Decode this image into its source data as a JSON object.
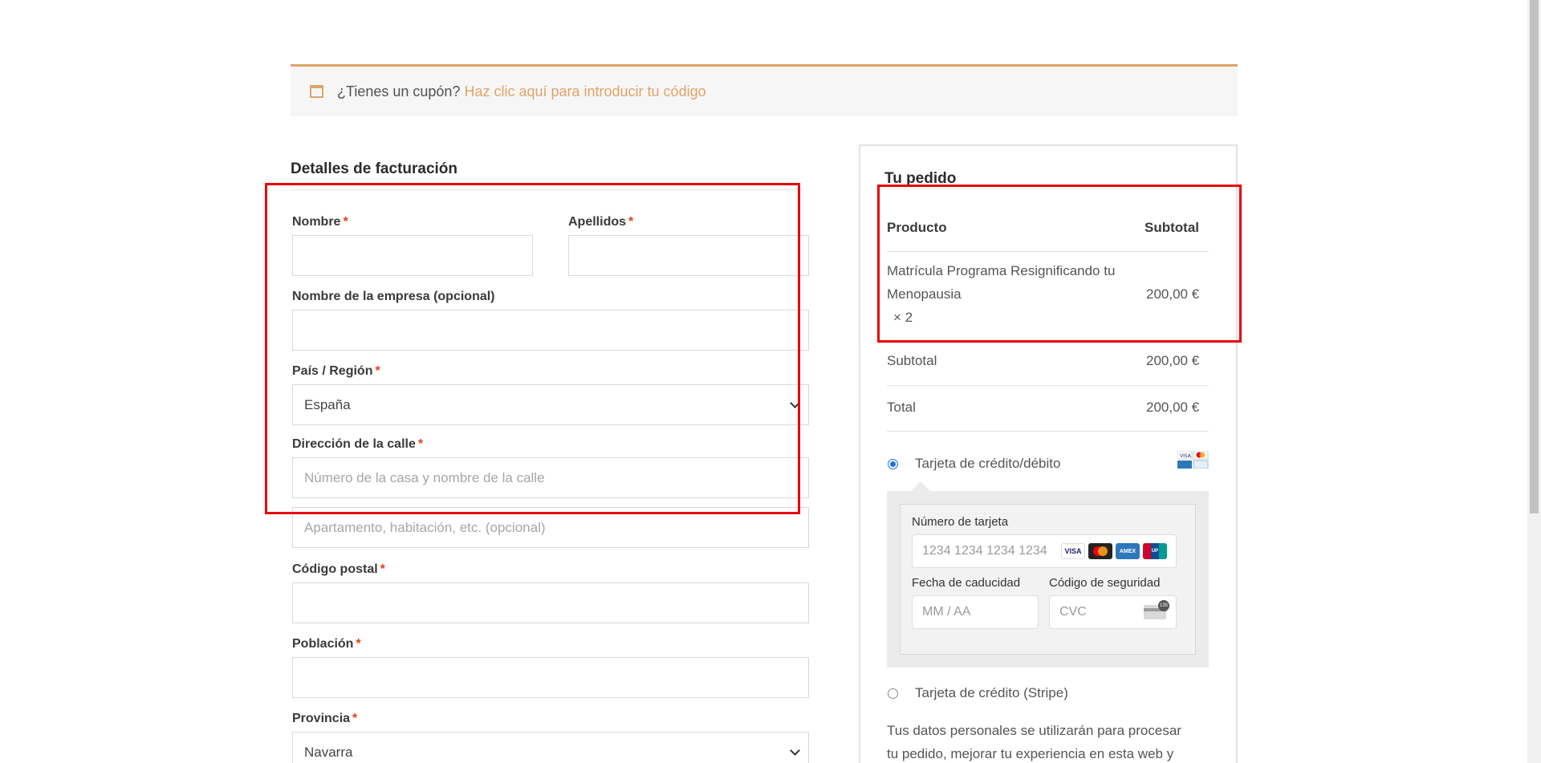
{
  "coupon": {
    "question": "¿Tienes un cupón?",
    "link": "Haz clic aquí para introducir tu código"
  },
  "billing": {
    "title": "Detalles de facturación",
    "first_name_label": "Nombre",
    "last_name_label": "Apellidos",
    "company_label": "Nombre de la empresa (opcional)",
    "country_label": "País / Región",
    "country_value": "España",
    "street_label": "Dirección de la calle",
    "street_placeholder": "Número de la casa y nombre de la calle",
    "street2_placeholder": "Apartamento, habitación, etc. (opcional)",
    "postcode_label": "Código postal",
    "city_label": "Población",
    "province_label": "Provincia",
    "province_value": "Navarra",
    "required_mark": "*"
  },
  "order": {
    "title": "Tu pedido",
    "col_product": "Producto",
    "col_subtotal": "Subtotal",
    "item_name_line1": "Matrícula Programa Resignificando tu",
    "item_name_line2": "Menopausia",
    "item_qty": "× 2",
    "item_price": "200,00 €",
    "subtotal_label": "Subtotal",
    "subtotal_value": "200,00 €",
    "total_label": "Total",
    "total_value": "200,00 €"
  },
  "payment": {
    "method1_label": "Tarjeta de crédito/débito",
    "card_number_label": "Número de tarjeta",
    "card_number_placeholder": "1234 1234 1234 1234",
    "expiry_label": "Fecha de caducidad",
    "expiry_placeholder": "MM / AA",
    "cvc_label": "Código de seguridad",
    "cvc_placeholder": "CVC",
    "method2_label": "Tarjeta de crédito (Stripe)",
    "card_brands": [
      "VISA",
      "Mastercard",
      "AMEX",
      "UnionPay"
    ],
    "cvc_badge": "135"
  },
  "privacy": {
    "line1": "Tus datos personales se utilizarán para procesar",
    "line2": "tu pedido, mejorar tu experiencia en esta web y"
  },
  "colors": {
    "accent": "#dfa466",
    "required": "#e2401c",
    "annotation_red": "#e8000b",
    "radio_selected": "#1a73e8"
  }
}
